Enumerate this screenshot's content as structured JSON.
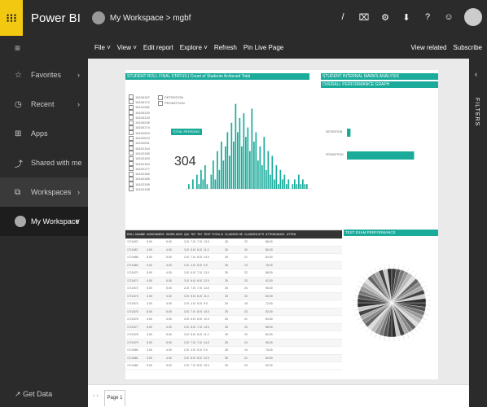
{
  "app": {
    "launcher_icon": "waffle-grid",
    "brand": "Power BI",
    "breadcrumb": "My Workspace > mgbf"
  },
  "top_icons": [
    "/",
    "⌧",
    "⚙",
    "⬇",
    "?",
    "☺"
  ],
  "toolbar": {
    "file": "File ˅",
    "view": "View ˅",
    "edit_report": "Edit report",
    "explore": "Explore ˅",
    "refresh": "Refresh",
    "pin": "Pin Live Page",
    "view_related": "View related",
    "subscribe": "Subscribe"
  },
  "sidebar": {
    "favorites": "Favorites",
    "recent": "Recent",
    "apps": "Apps",
    "shared": "Shared with me",
    "workspaces": "Workspaces",
    "my_workspace": "My Workspace",
    "get_data": "Get Data"
  },
  "filters_label": "FILTERS",
  "report": {
    "header_left": "STUDENT ROLL FINAL STATUS  |  Count of Students Achieved Total",
    "header_right_1": "STUDENT INTERNAL MARKS ANALYSIS",
    "header_right_2": "OVERALL PERFORMANCE GRAPH",
    "slicer_items": [
      "15100187",
      "15100172",
      "15101108",
      "15100120",
      "15100133",
      "15100236",
      "15100174",
      "15102043",
      "15102010",
      "15102031",
      "15102154",
      "15102155",
      "15102163",
      "15102164",
      "15102177",
      "15102180",
      "15102185",
      "15102195",
      "15102198"
    ],
    "opt_detention": "DETENTION",
    "opt_promotion": "PROMOTION",
    "card_label": "TOTAL PERSONS",
    "card_value": "304",
    "bar_labels": [
      "DETENTION",
      "PROMOTION"
    ],
    "pie_title": "TEST EXAM PERFORMANCE"
  },
  "table": {
    "headers": [
      "ROLL NUMBER",
      "ASSIGNMENT THY",
      "WORK ASSIGNMENT",
      "QUIZ",
      "TEST 1",
      "TEST 2",
      "TEST TOTAL MARKS",
      "CLASSES HELD",
      "CLASSES ATTENDED",
      "ATTENDANCE PERCENTAGE",
      "ATTEN"
    ],
    "rows": [
      [
        "1710497",
        "5.00",
        "5.00",
        "3.00",
        "7.00",
        "7.00",
        "13.0",
        "25",
        "22",
        "88.00"
      ],
      [
        "1710467",
        "4.00",
        "4.00",
        "3.00",
        "5.00",
        "6.00",
        "11.0",
        "25",
        "20",
        "80.00"
      ],
      [
        "1710468",
        "5.00",
        "5.00",
        "2.00",
        "7.00",
        "8.00",
        "14.0",
        "25",
        "21",
        "84.00"
      ],
      [
        "1710469",
        "3.00",
        "4.00",
        "2.00",
        "4.00",
        "5.00",
        "9.0",
        "25",
        "19",
        "76.00"
      ],
      [
        "1710470",
        "5.00",
        "4.00",
        "3.00",
        "6.00",
        "7.00",
        "13.0",
        "25",
        "22",
        "88.00"
      ],
      [
        "1710471",
        "4.00",
        "5.00",
        "3.00",
        "6.00",
        "6.00",
        "12.0",
        "25",
        "23",
        "92.00"
      ],
      [
        "1710472",
        "5.00",
        "5.00",
        "2.00",
        "7.00",
        "7.00",
        "14.0",
        "25",
        "24",
        "96.00"
      ],
      [
        "1710473",
        "4.00",
        "4.00",
        "3.00",
        "5.00",
        "6.00",
        "11.0",
        "25",
        "20",
        "80.00"
      ],
      [
        "1710474",
        "3.00",
        "3.00",
        "2.00",
        "4.00",
        "5.00",
        "9.0",
        "25",
        "18",
        "72.00"
      ],
      [
        "1710475",
        "5.00",
        "5.00",
        "3.00",
        "7.00",
        "8.00",
        "15.0",
        "25",
        "23",
        "92.00"
      ],
      [
        "1710476",
        "4.00",
        "4.00",
        "3.00",
        "6.00",
        "6.00",
        "12.0",
        "25",
        "21",
        "84.00"
      ],
      [
        "1710477",
        "5.00",
        "4.00",
        "2.00",
        "6.00",
        "7.00",
        "13.0",
        "25",
        "22",
        "88.00"
      ],
      [
        "1710478",
        "4.00",
        "5.00",
        "3.00",
        "5.00",
        "6.00",
        "11.0",
        "25",
        "20",
        "80.00"
      ],
      [
        "1710479",
        "5.00",
        "5.00",
        "3.00",
        "7.00",
        "7.00",
        "14.0",
        "25",
        "24",
        "96.00"
      ],
      [
        "1710480",
        "3.00",
        "4.00",
        "2.00",
        "4.00",
        "5.00",
        "9.0",
        "25",
        "19",
        "76.00"
      ],
      [
        "1710481",
        "4.00",
        "4.00",
        "3.00",
        "6.00",
        "6.00",
        "12.0",
        "25",
        "21",
        "84.00"
      ],
      [
        "1710482",
        "5.00",
        "5.00",
        "2.00",
        "7.00",
        "8.00",
        "15.0",
        "25",
        "23",
        "92.00"
      ]
    ]
  },
  "footer": {
    "page_nav": "‹ ›",
    "page_tab": "Page 1"
  },
  "colors": {
    "accent": "#1aab9b",
    "chrome": "#2b2b2b",
    "launcher": "#f2c811"
  },
  "chart_data": [
    {
      "type": "bar",
      "ylim": [
        0,
        20
      ],
      "values": [
        1,
        0,
        2,
        0,
        3,
        1,
        4,
        2,
        5,
        1,
        0,
        3,
        6,
        2,
        8,
        4,
        10,
        6,
        9,
        12,
        7,
        14,
        10,
        18,
        12,
        15,
        9,
        16,
        11,
        13,
        8,
        17,
        10,
        12,
        6,
        9,
        5,
        11,
        4,
        8,
        3,
        7,
        2,
        5,
        1,
        4,
        2,
        3,
        1,
        2,
        0,
        1,
        2,
        1,
        3,
        1,
        2,
        1,
        1,
        0
      ]
    },
    {
      "type": "bar",
      "orientation": "horizontal",
      "categories": [
        "DETENTION",
        "PROMOTION"
      ],
      "values": [
        16,
        300
      ],
      "xlim": [
        0,
        400
      ]
    },
    {
      "type": "pie",
      "title": "TEST EXAM PERFORMANCE",
      "slice_count": 48
    }
  ]
}
